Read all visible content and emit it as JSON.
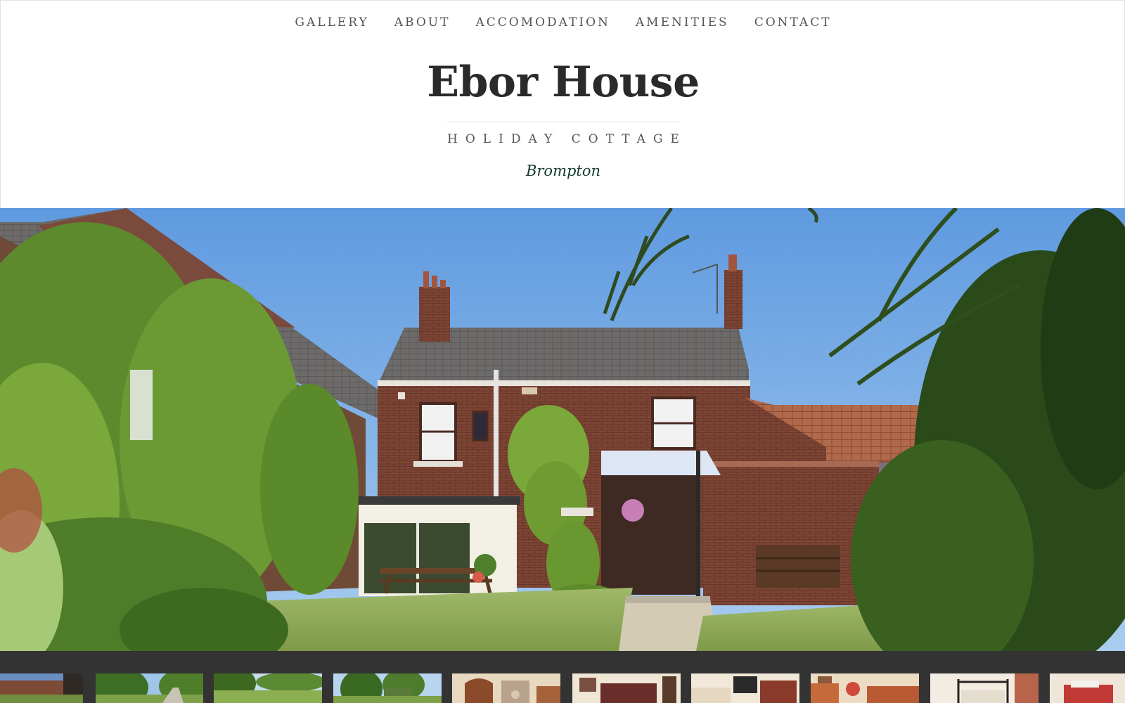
{
  "nav": {
    "items": [
      {
        "label": "GALLERY"
      },
      {
        "label": "ABOUT"
      },
      {
        "label": "ACCOMODATION"
      },
      {
        "label": "AMENITIES"
      },
      {
        "label": "CONTACT"
      }
    ]
  },
  "site": {
    "title": "Ebor House",
    "tagline": "HOLIDAY COTTAGE",
    "location": "Brompton"
  },
  "colors": {
    "nav_text": "#555555",
    "title_text": "#2a2a2a",
    "location_text": "#123a2a",
    "thumbnail_strip_bg": "#333333"
  },
  "hero": {
    "icon": "hero-photo-house-garden"
  },
  "thumbnails": {
    "count_visible": 10,
    "icons": [
      "thumb-exterior",
      "thumb-garden-path",
      "thumb-lawn",
      "thumb-trees",
      "thumb-dining-room",
      "thumb-dining-table",
      "thumb-lounge",
      "thumb-sofa-room",
      "thumb-bedroom",
      "thumb-bedroom-red"
    ]
  }
}
